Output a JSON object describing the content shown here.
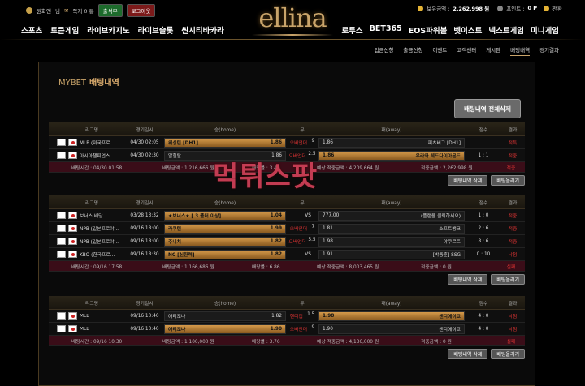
{
  "topbar": {
    "username": "원화엔",
    "honorific": "님",
    "messages": "쪽지 0 통",
    "attendance": "출석부",
    "logout": "로그아웃",
    "balance_label": "보유금액 :",
    "balance": "2,262,998 원",
    "point_label": "포인트 :",
    "point": "0 P",
    "convert": "전환"
  },
  "logo": "ellina",
  "nav_left": [
    "스포츠",
    "토큰게임",
    "라이브카지노",
    "라이브슬롯",
    "씬시티바카라"
  ],
  "nav_right": [
    "로투스",
    "BET365",
    "EOS파워볼",
    "벳이스트",
    "넥스트게임",
    "미니게임"
  ],
  "subnav": [
    "입금신청",
    "출금신청",
    "이벤트",
    "고객센터",
    "게시판",
    "배팅내역",
    "경기결과"
  ],
  "panel": {
    "prefix": "MYBET",
    "title": "배팅내역",
    "delete_all": "배팅내역 전체삭제"
  },
  "headers": {
    "league": "리그명",
    "time": "경기일시",
    "home": "승(home)",
    "draw": "무",
    "away": "패(away)",
    "score": "점수",
    "result": "결과"
  },
  "buttons": {
    "delete": "배팅내역 삭제",
    "upload": "배팅올리기"
  },
  "bets": [
    {
      "rows": [
        {
          "league": "MLB (미국프로...",
          "time": "04/30 02:05",
          "home": "워싱턴 [DH1]",
          "home_odd": "1.86",
          "draw": "9",
          "draw_label": "오버언더",
          "away": "피츠버그 [DH1]",
          "away_odd": "1.86",
          "score": "",
          "result": "적특",
          "sel": "home",
          "rescolor": "red"
        },
        {
          "league": "아시아챔피언스...",
          "time": "04/30 02:30",
          "home": "알힐랄",
          "home_odd": "1.86",
          "draw": "2.5",
          "draw_label": "오버언더",
          "away": "우라와 레드다이아몬드",
          "away_odd": "1.86",
          "score": "1 : 1",
          "result": "적중",
          "sel": "away",
          "rescolor": "red"
        }
      ],
      "summary": {
        "time": "배팅시간 : 04/30 01:58",
        "amount": "배팅금액 : 1,216,666 원",
        "odds": "배당률 : 3.46",
        "expect": "예상 적중금액 : 4,209,664 원",
        "win": "적중금액 : 2,262,998 원",
        "result": "적중"
      }
    },
    {
      "rows": [
        {
          "league": "보너스 배당",
          "time": "03/28 13:32",
          "home": "★보너스★ [ 3 폴더 이상]",
          "home_odd": "1.04",
          "draw": "VS",
          "draw_label": "",
          "away": "(플랜을 클릭하세요)",
          "away_odd": "777.00",
          "score": "1 : 0",
          "result": "적중",
          "sel": "home",
          "rescolor": "red"
        },
        {
          "league": "NPB (일본프로야...",
          "time": "09/16 18:00",
          "home": "라쿠텐",
          "home_odd": "1.99",
          "draw": "7",
          "draw_label": "오버언더",
          "away": "소프트뱅크",
          "away_odd": "1.81",
          "score": "2 : 6",
          "result": "적중",
          "sel": "home",
          "rescolor": "red"
        },
        {
          "league": "NPB (일본프로야...",
          "time": "09/16 18:00",
          "home": "주니치",
          "home_odd": "1.82",
          "draw": "5.5",
          "draw_label": "오버언더",
          "away": "야쿠르트",
          "away_odd": "1.98",
          "score": "8 : 6",
          "result": "적중",
          "sel": "home",
          "rescolor": "red"
        },
        {
          "league": "KBO (한국프로...",
          "time": "09/16 18:30",
          "home": "NC [신한력]",
          "home_odd": "1.82",
          "draw": "VS",
          "draw_label": "",
          "away": "[박종훈] SSG",
          "away_odd": "1.91",
          "score": "0 : 10",
          "result": "낙첨",
          "sel": "home",
          "rescolor": "red"
        }
      ],
      "summary": {
        "time": "배팅시간 : 09/16 17:58",
        "amount": "배팅금액 : 1,166,686 원",
        "odds": "배당률 : 6.86",
        "expect": "예상 적중금액 : 8,003,465 원",
        "win": "적중금액 : 0 원",
        "result": "실패"
      }
    },
    {
      "rows": [
        {
          "league": "MLB",
          "time": "09/16 10:40",
          "home": "애리조나",
          "home_odd": "1.82",
          "draw": "1.5",
          "draw_label": "핸디캡",
          "away": "샌디에이고",
          "away_odd": "1.98",
          "score": "4 : 0",
          "result": "낙첨",
          "sel": "away",
          "rescolor": "red"
        },
        {
          "league": "MLB",
          "time": "09/16 10:40",
          "home": "애리조나",
          "home_odd": "1.90",
          "draw": "9",
          "draw_label": "오버언더",
          "away": "샌디에이고",
          "away_odd": "1.90",
          "score": "4 : 0",
          "result": "낙첨",
          "sel": "home",
          "rescolor": "red"
        }
      ],
      "summary": {
        "time": "배팅시간 : 09/16 10:30",
        "amount": "배팅금액 : 1,100,000 원",
        "odds": "배당률 : 3.76",
        "expect": "예상 적중금액 : 4,136,000 원",
        "win": "적중금액 : 0 원",
        "result": "실패"
      }
    }
  ],
  "watermark": "먹튀스팟"
}
